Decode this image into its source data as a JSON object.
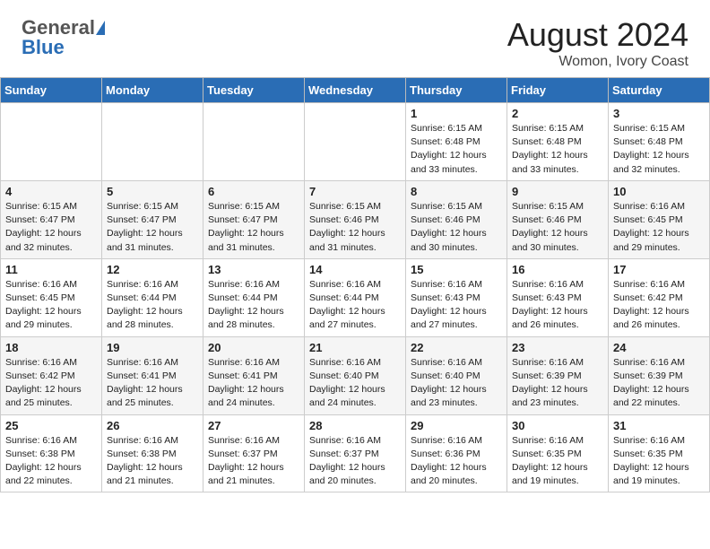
{
  "header": {
    "logo_general": "General",
    "logo_blue": "Blue",
    "title": "August 2024",
    "subtitle": "Womon, Ivory Coast"
  },
  "weekdays": [
    "Sunday",
    "Monday",
    "Tuesday",
    "Wednesday",
    "Thursday",
    "Friday",
    "Saturday"
  ],
  "weeks": [
    [
      {
        "day": "",
        "info": ""
      },
      {
        "day": "",
        "info": ""
      },
      {
        "day": "",
        "info": ""
      },
      {
        "day": "",
        "info": ""
      },
      {
        "day": "1",
        "info": "Sunrise: 6:15 AM\nSunset: 6:48 PM\nDaylight: 12 hours\nand 33 minutes."
      },
      {
        "day": "2",
        "info": "Sunrise: 6:15 AM\nSunset: 6:48 PM\nDaylight: 12 hours\nand 33 minutes."
      },
      {
        "day": "3",
        "info": "Sunrise: 6:15 AM\nSunset: 6:48 PM\nDaylight: 12 hours\nand 32 minutes."
      }
    ],
    [
      {
        "day": "4",
        "info": "Sunrise: 6:15 AM\nSunset: 6:47 PM\nDaylight: 12 hours\nand 32 minutes."
      },
      {
        "day": "5",
        "info": "Sunrise: 6:15 AM\nSunset: 6:47 PM\nDaylight: 12 hours\nand 31 minutes."
      },
      {
        "day": "6",
        "info": "Sunrise: 6:15 AM\nSunset: 6:47 PM\nDaylight: 12 hours\nand 31 minutes."
      },
      {
        "day": "7",
        "info": "Sunrise: 6:15 AM\nSunset: 6:46 PM\nDaylight: 12 hours\nand 31 minutes."
      },
      {
        "day": "8",
        "info": "Sunrise: 6:15 AM\nSunset: 6:46 PM\nDaylight: 12 hours\nand 30 minutes."
      },
      {
        "day": "9",
        "info": "Sunrise: 6:15 AM\nSunset: 6:46 PM\nDaylight: 12 hours\nand 30 minutes."
      },
      {
        "day": "10",
        "info": "Sunrise: 6:16 AM\nSunset: 6:45 PM\nDaylight: 12 hours\nand 29 minutes."
      }
    ],
    [
      {
        "day": "11",
        "info": "Sunrise: 6:16 AM\nSunset: 6:45 PM\nDaylight: 12 hours\nand 29 minutes."
      },
      {
        "day": "12",
        "info": "Sunrise: 6:16 AM\nSunset: 6:44 PM\nDaylight: 12 hours\nand 28 minutes."
      },
      {
        "day": "13",
        "info": "Sunrise: 6:16 AM\nSunset: 6:44 PM\nDaylight: 12 hours\nand 28 minutes."
      },
      {
        "day": "14",
        "info": "Sunrise: 6:16 AM\nSunset: 6:44 PM\nDaylight: 12 hours\nand 27 minutes."
      },
      {
        "day": "15",
        "info": "Sunrise: 6:16 AM\nSunset: 6:43 PM\nDaylight: 12 hours\nand 27 minutes."
      },
      {
        "day": "16",
        "info": "Sunrise: 6:16 AM\nSunset: 6:43 PM\nDaylight: 12 hours\nand 26 minutes."
      },
      {
        "day": "17",
        "info": "Sunrise: 6:16 AM\nSunset: 6:42 PM\nDaylight: 12 hours\nand 26 minutes."
      }
    ],
    [
      {
        "day": "18",
        "info": "Sunrise: 6:16 AM\nSunset: 6:42 PM\nDaylight: 12 hours\nand 25 minutes."
      },
      {
        "day": "19",
        "info": "Sunrise: 6:16 AM\nSunset: 6:41 PM\nDaylight: 12 hours\nand 25 minutes."
      },
      {
        "day": "20",
        "info": "Sunrise: 6:16 AM\nSunset: 6:41 PM\nDaylight: 12 hours\nand 24 minutes."
      },
      {
        "day": "21",
        "info": "Sunrise: 6:16 AM\nSunset: 6:40 PM\nDaylight: 12 hours\nand 24 minutes."
      },
      {
        "day": "22",
        "info": "Sunrise: 6:16 AM\nSunset: 6:40 PM\nDaylight: 12 hours\nand 23 minutes."
      },
      {
        "day": "23",
        "info": "Sunrise: 6:16 AM\nSunset: 6:39 PM\nDaylight: 12 hours\nand 23 minutes."
      },
      {
        "day": "24",
        "info": "Sunrise: 6:16 AM\nSunset: 6:39 PM\nDaylight: 12 hours\nand 22 minutes."
      }
    ],
    [
      {
        "day": "25",
        "info": "Sunrise: 6:16 AM\nSunset: 6:38 PM\nDaylight: 12 hours\nand 22 minutes."
      },
      {
        "day": "26",
        "info": "Sunrise: 6:16 AM\nSunset: 6:38 PM\nDaylight: 12 hours\nand 21 minutes."
      },
      {
        "day": "27",
        "info": "Sunrise: 6:16 AM\nSunset: 6:37 PM\nDaylight: 12 hours\nand 21 minutes."
      },
      {
        "day": "28",
        "info": "Sunrise: 6:16 AM\nSunset: 6:37 PM\nDaylight: 12 hours\nand 20 minutes."
      },
      {
        "day": "29",
        "info": "Sunrise: 6:16 AM\nSunset: 6:36 PM\nDaylight: 12 hours\nand 20 minutes."
      },
      {
        "day": "30",
        "info": "Sunrise: 6:16 AM\nSunset: 6:35 PM\nDaylight: 12 hours\nand 19 minutes."
      },
      {
        "day": "31",
        "info": "Sunrise: 6:16 AM\nSunset: 6:35 PM\nDaylight: 12 hours\nand 19 minutes."
      }
    ]
  ]
}
